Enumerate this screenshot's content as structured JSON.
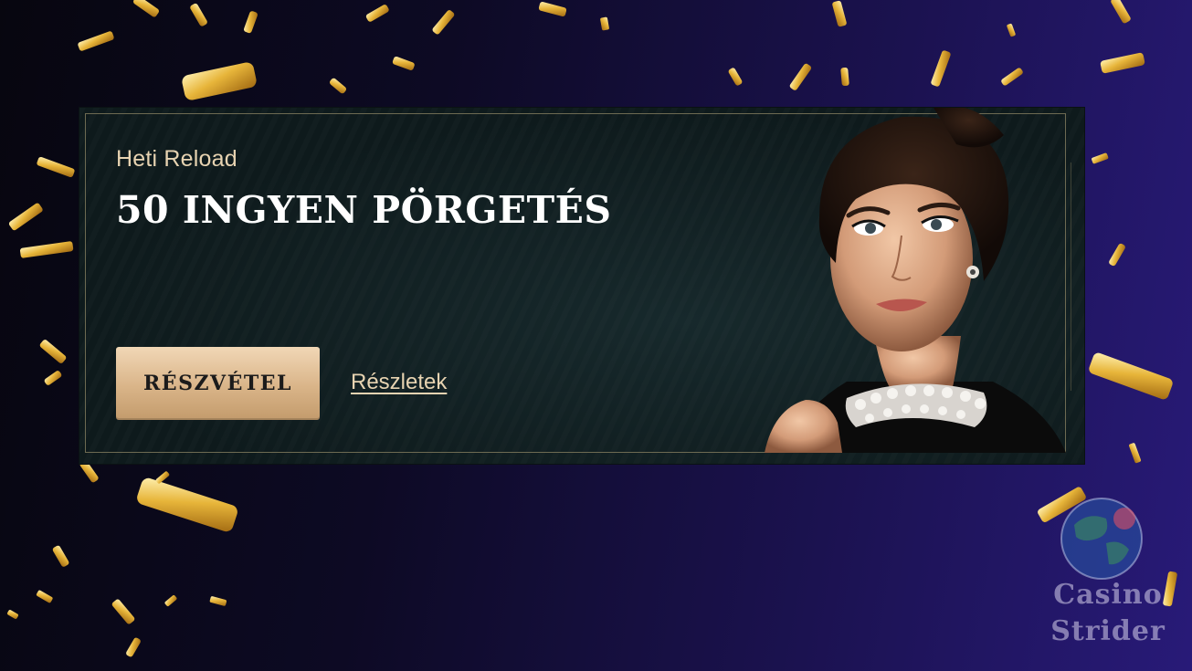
{
  "banner": {
    "subtitle": "Heti Reload",
    "headline": "50 INGYEN PÖRGETÉS",
    "cta_label": "RÉSZVÉTEL",
    "details_label": "Részletek"
  },
  "watermark": {
    "line1": "Casino",
    "line2": "Strider"
  },
  "colors": {
    "accent_gold": "#d9b488",
    "text_gold": "#e7d3b1",
    "banner_bg": "#0e1a1c",
    "bg_right": "#281a78"
  },
  "icons": [
    "confetti",
    "woman-portrait",
    "casino-strider-globe-logo"
  ]
}
